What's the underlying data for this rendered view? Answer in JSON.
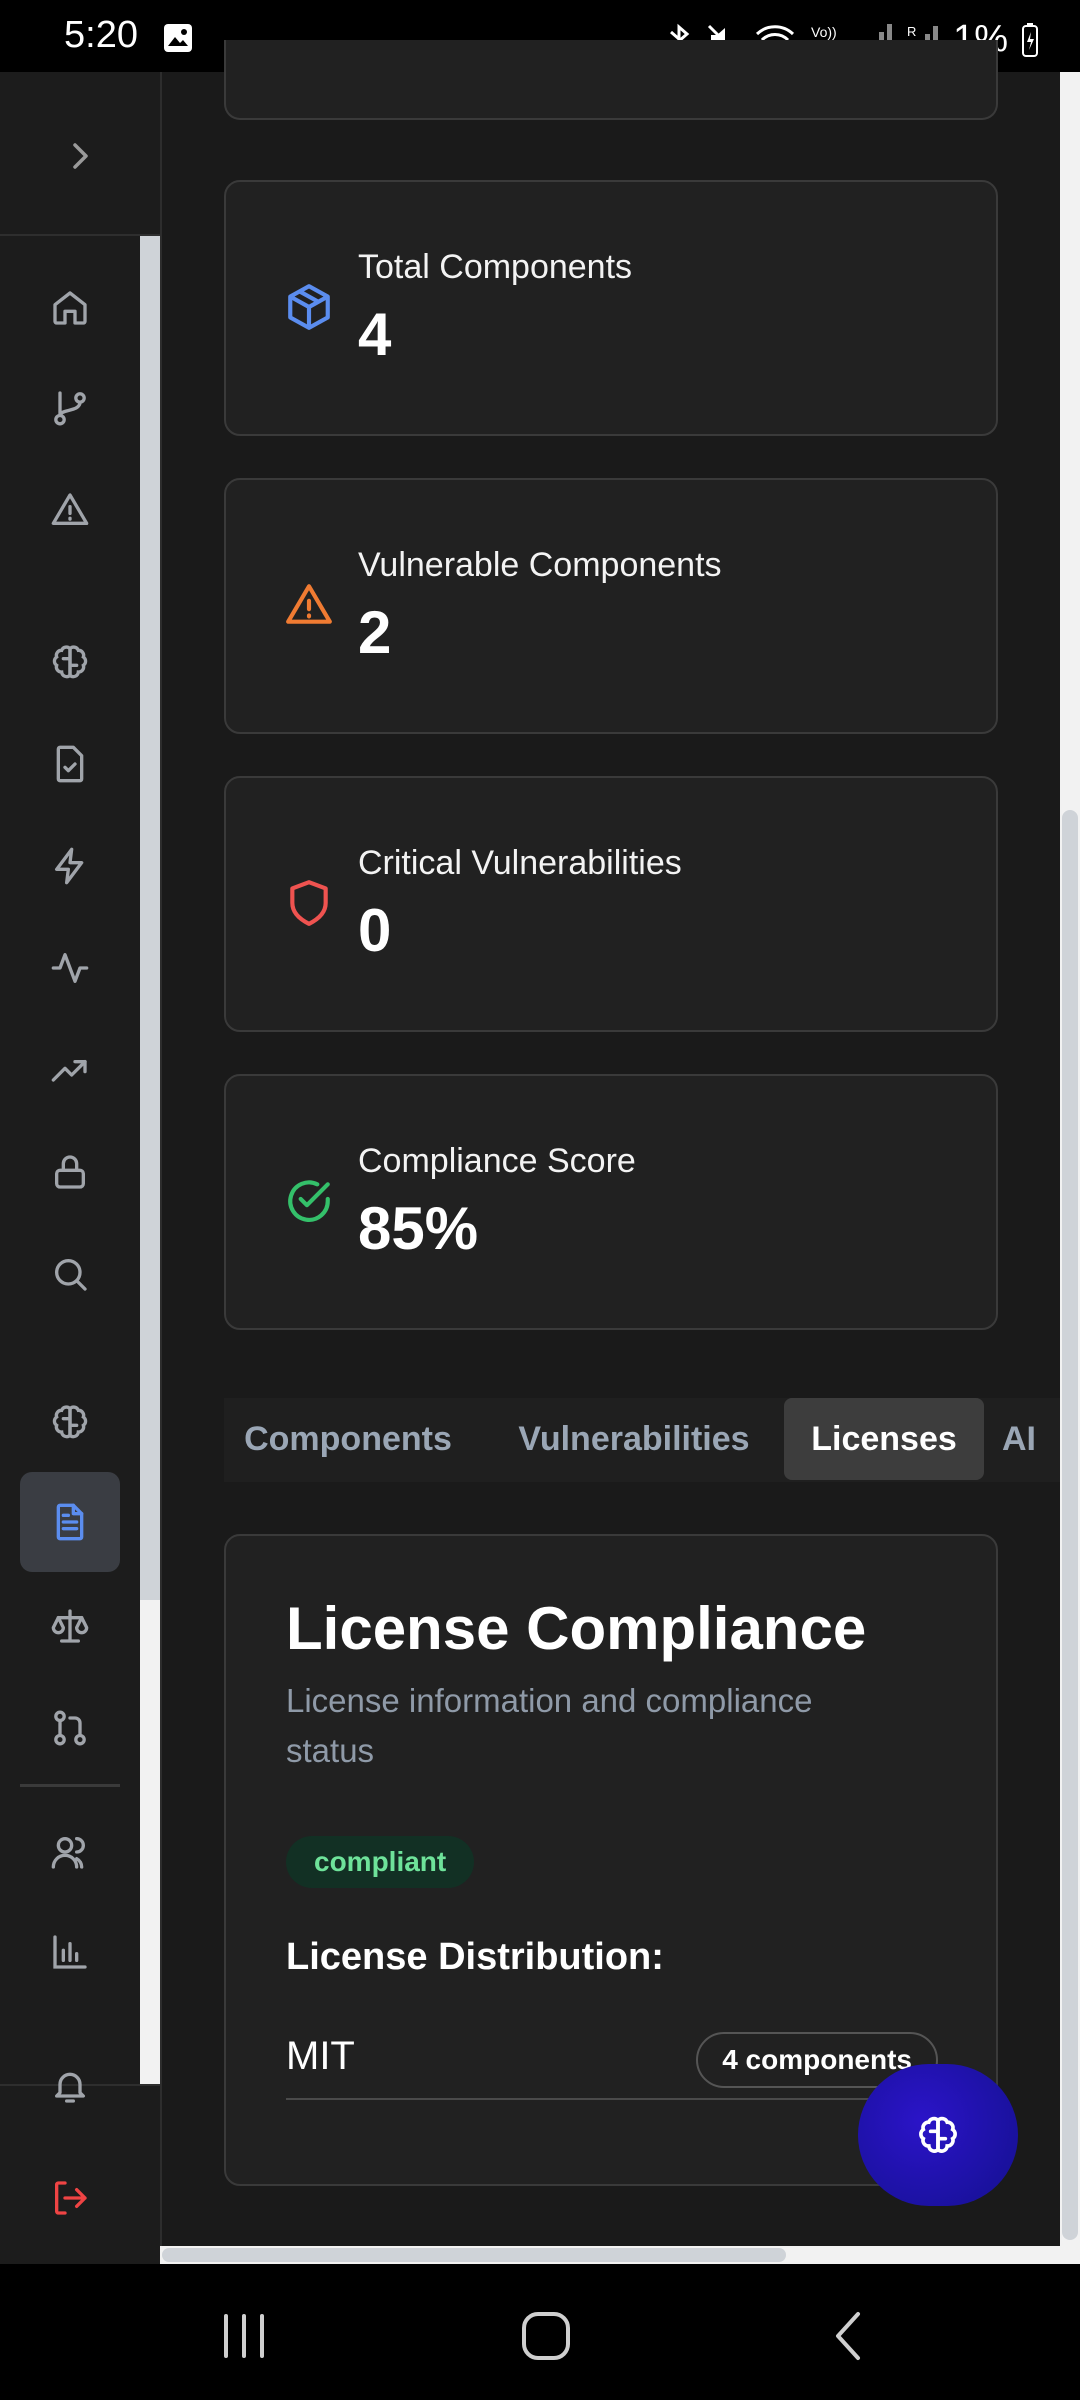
{
  "status_bar": {
    "time": "5:20",
    "battery": "1%"
  },
  "stats": [
    {
      "label": "Total Components",
      "value": "4",
      "icon": "cube-icon",
      "color": "#5b8def"
    },
    {
      "label": "Vulnerable Components",
      "value": "2",
      "icon": "warning-icon",
      "color": "#f07b32"
    },
    {
      "label": "Critical Vulnerabilities",
      "value": "0",
      "icon": "shield-icon",
      "color": "#ef5350"
    },
    {
      "label": "Compliance Score",
      "value": "85%",
      "icon": "check-circle-icon",
      "color": "#34c06a"
    }
  ],
  "tabs": [
    {
      "label": "Components",
      "active": false
    },
    {
      "label": "Vulnerabilities",
      "active": false
    },
    {
      "label": "Licenses",
      "active": true
    },
    {
      "label": "AI",
      "active": false
    }
  ],
  "license": {
    "title": "License Compliance",
    "subtitle": "License information and compliance status",
    "status_badge": "compliant",
    "distribution_title": "License Distribution:",
    "rows": [
      {
        "name": "MIT",
        "count": "4 components"
      }
    ]
  },
  "sidebar": {
    "items": [
      "home-icon",
      "git-branch-icon",
      "alert-triangle-icon",
      "brain-icon",
      "file-check-icon",
      "zap-icon",
      "activity-icon",
      "trending-up-icon",
      "lock-icon",
      "search-icon",
      "brain-icon",
      "file-text-icon",
      "scale-icon",
      "git-pull-request-icon",
      "users-icon",
      "bar-chart-icon",
      "bell-icon",
      "logout-icon"
    ],
    "active": "file-text-icon"
  }
}
